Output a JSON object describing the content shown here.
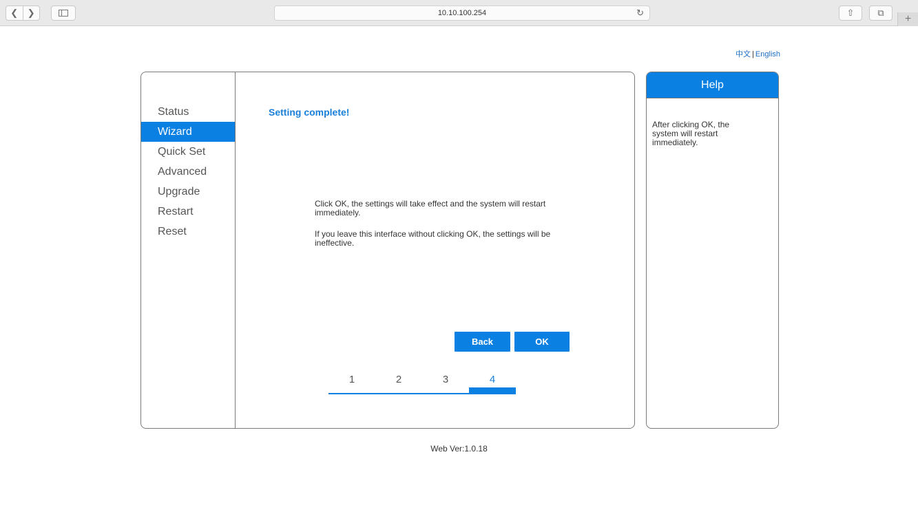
{
  "browser": {
    "url": "10.10.100.254",
    "back_glyph": "❮",
    "forward_glyph": "❯",
    "reload_glyph": "↻",
    "share_glyph": "⇧",
    "tabs_glyph": "⧉",
    "newtab_glyph": "+"
  },
  "language": {
    "chinese": "中文",
    "separator": "|",
    "english": "English"
  },
  "menu": {
    "items": [
      {
        "label": "Status"
      },
      {
        "label": "Wizard",
        "active": true
      },
      {
        "label": "Quick Set"
      },
      {
        "label": "Advanced"
      },
      {
        "label": "Upgrade"
      },
      {
        "label": "Restart"
      },
      {
        "label": "Reset"
      }
    ]
  },
  "content": {
    "title": "Setting complete!",
    "message_1": "Click OK, the settings will take effect and the system will restart immediately.",
    "message_2": "If you leave this interface without clicking OK, the settings will be ineffective.",
    "back_label": "Back",
    "ok_label": "OK"
  },
  "steps": {
    "labels": [
      "1",
      "2",
      "3",
      "4"
    ],
    "current": 4
  },
  "help": {
    "title": "Help",
    "text": "After clicking OK, the system will restart immediately."
  },
  "footer": {
    "version": "Web Ver:1.0.18"
  },
  "colors": {
    "accent": "#0b80e3",
    "link": "#1e6fc8"
  }
}
